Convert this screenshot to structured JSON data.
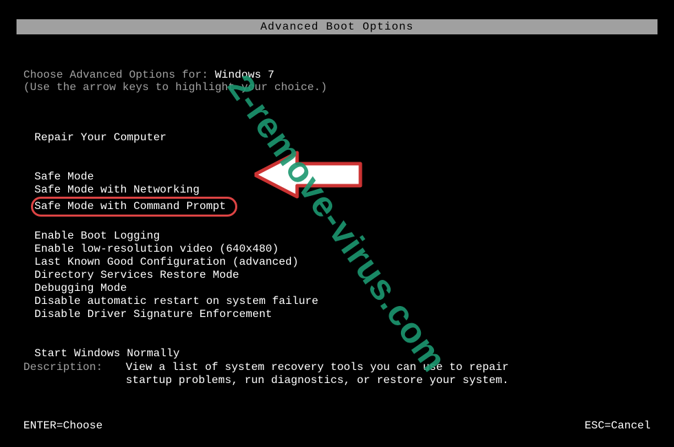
{
  "title": "Advanced Boot Options",
  "choose_prefix": "Choose Advanced Options for: ",
  "os_name": "Windows 7",
  "hint": "(Use the arrow keys to highlight your choice.)",
  "repair": "Repair Your Computer",
  "options": {
    "safe_mode": "Safe Mode",
    "safe_mode_net": "Safe Mode with Networking",
    "safe_mode_cmd": "Safe Mode with Command Prompt",
    "boot_logging": "Enable Boot Logging",
    "low_res": "Enable low-resolution video (640x480)",
    "lkgc": "Last Known Good Configuration (advanced)",
    "dsrm": "Directory Services Restore Mode",
    "debug": "Debugging Mode",
    "no_restart": "Disable automatic restart on system failure",
    "no_sig": "Disable Driver Signature Enforcement",
    "normal": "Start Windows Normally"
  },
  "desc_label": "Description:",
  "desc_text": "View a list of system recovery tools you can use to repair startup problems, run diagnostics, or restore your system.",
  "footer_left": "ENTER=Choose",
  "footer_right": "ESC=Cancel",
  "watermark": "2-remove-virus.com"
}
